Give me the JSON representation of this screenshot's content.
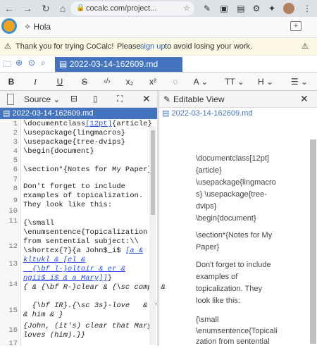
{
  "browser": {
    "url": "cocalc.com/project..."
  },
  "app": {
    "greeting": "Hola"
  },
  "banner": {
    "thanks": "Thank you for trying CoCalc!",
    "please": "Please",
    "signup": "sign up",
    "rest": "to avoid losing your work."
  },
  "tab": {
    "filename": "2022-03-14-162609.md"
  },
  "toolbar": {
    "bold": "B",
    "italic": "I",
    "underline": "U",
    "strike": "S",
    "code": "‹/›",
    "sub": "x₂",
    "sup": "x²",
    "bubble": "◌",
    "font": "A",
    "textsize": "TT",
    "heading": "H"
  },
  "left": {
    "source_label": "Source",
    "file": "2022-03-14-162609.md",
    "line_numbers": [
      "1",
      "2",
      "3",
      "4",
      "5",
      "6",
      "7",
      "8",
      "9",
      "10",
      "11",
      "12",
      "13",
      "14",
      "15",
      "16",
      "17"
    ]
  },
  "right": {
    "editable_label": "Editable View",
    "file": "2022-03-14-162609.md",
    "preview": [
      "\\documentclass[12pt]",
      "{article}",
      "\\usepackage{lingmacro",
      "s} \\usepackage{tree-",
      "dvips}",
      "\\begin{document}",
      "\\section*{Notes for My",
      "Paper}",
      "Don't forget to include",
      "examples of",
      "topicalization. They",
      "look like this:",
      "{\\small",
      "\\enumsentence{Topicali",
      "zation from sentential"
    ]
  }
}
